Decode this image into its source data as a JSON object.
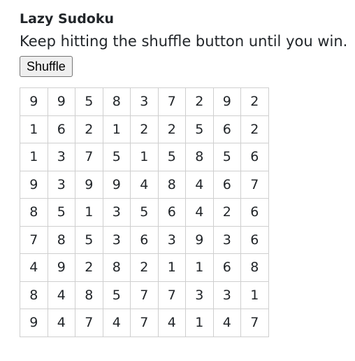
{
  "app": {
    "title": "Lazy Sudoku",
    "subtitle": "Keep hitting the shuffle button until you win.",
    "shuffle_label": "Shuffle"
  },
  "grid": {
    "rows": [
      [
        "9",
        "9",
        "5",
        "8",
        "3",
        "7",
        "2",
        "9",
        "2"
      ],
      [
        "1",
        "6",
        "2",
        "1",
        "2",
        "2",
        "5",
        "6",
        "2"
      ],
      [
        "1",
        "3",
        "7",
        "5",
        "1",
        "5",
        "8",
        "5",
        "6"
      ],
      [
        "9",
        "3",
        "9",
        "9",
        "4",
        "8",
        "4",
        "6",
        "7"
      ],
      [
        "8",
        "5",
        "1",
        "3",
        "5",
        "6",
        "4",
        "2",
        "6"
      ],
      [
        "7",
        "8",
        "5",
        "3",
        "6",
        "3",
        "9",
        "3",
        "6"
      ],
      [
        "4",
        "9",
        "2",
        "8",
        "2",
        "1",
        "1",
        "6",
        "8"
      ],
      [
        "8",
        "4",
        "8",
        "5",
        "7",
        "7",
        "3",
        "3",
        "1"
      ],
      [
        "9",
        "4",
        "7",
        "4",
        "7",
        "4",
        "1",
        "4",
        "7"
      ]
    ]
  }
}
